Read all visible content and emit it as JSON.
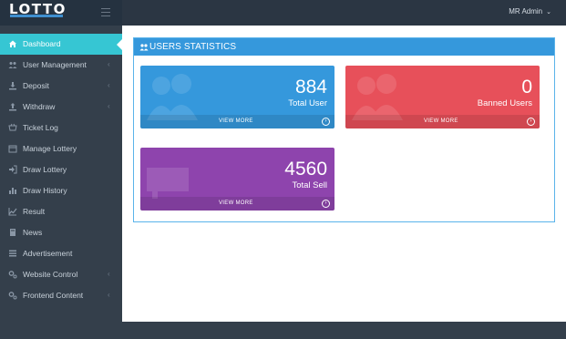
{
  "header": {
    "logo_text": "LOTTO",
    "user_label": "MR Admin"
  },
  "sidebar": {
    "items": [
      {
        "label": "Dashboard",
        "icon": "home-icon",
        "chevron": false,
        "active": true
      },
      {
        "label": "User Management",
        "icon": "users-icon",
        "chevron": true
      },
      {
        "label": "Deposit",
        "icon": "download-icon",
        "chevron": true
      },
      {
        "label": "Withdraw",
        "icon": "upload-icon",
        "chevron": true
      },
      {
        "label": "Ticket Log",
        "icon": "basket-icon",
        "chevron": false
      },
      {
        "label": "Manage Lottery",
        "icon": "calendar-icon",
        "chevron": false
      },
      {
        "label": "Draw Lottery",
        "icon": "sign-in-icon",
        "chevron": false
      },
      {
        "label": "Draw History",
        "icon": "chart-icon",
        "chevron": false
      },
      {
        "label": "Result",
        "icon": "line-chart-icon",
        "chevron": false
      },
      {
        "label": "News",
        "icon": "book-icon",
        "chevron": false
      },
      {
        "label": "Advertisement",
        "icon": "list-icon",
        "chevron": false
      },
      {
        "label": "Website Control",
        "icon": "cogs-icon",
        "chevron": true
      },
      {
        "label": "Frontend Content",
        "icon": "cogs-icon",
        "chevron": true
      }
    ]
  },
  "main": {
    "portlet_title": "USERS STATISTICS",
    "stats": [
      {
        "value": "884",
        "label": "Total User",
        "link": "VIEW MORE",
        "color": "#3598dc"
      },
      {
        "value": "0",
        "label": "Banned Users",
        "link": "VIEW MORE",
        "color": "#e7505a"
      },
      {
        "value": "4560",
        "label": "Total Sell",
        "link": "VIEW MORE",
        "color": "#8e44ad"
      }
    ]
  },
  "colors": {
    "accent": "#36c6d3",
    "header_bg": "#2b3643",
    "sidebar_bg": "#343f4b",
    "portlet_head": "#3598dc"
  }
}
